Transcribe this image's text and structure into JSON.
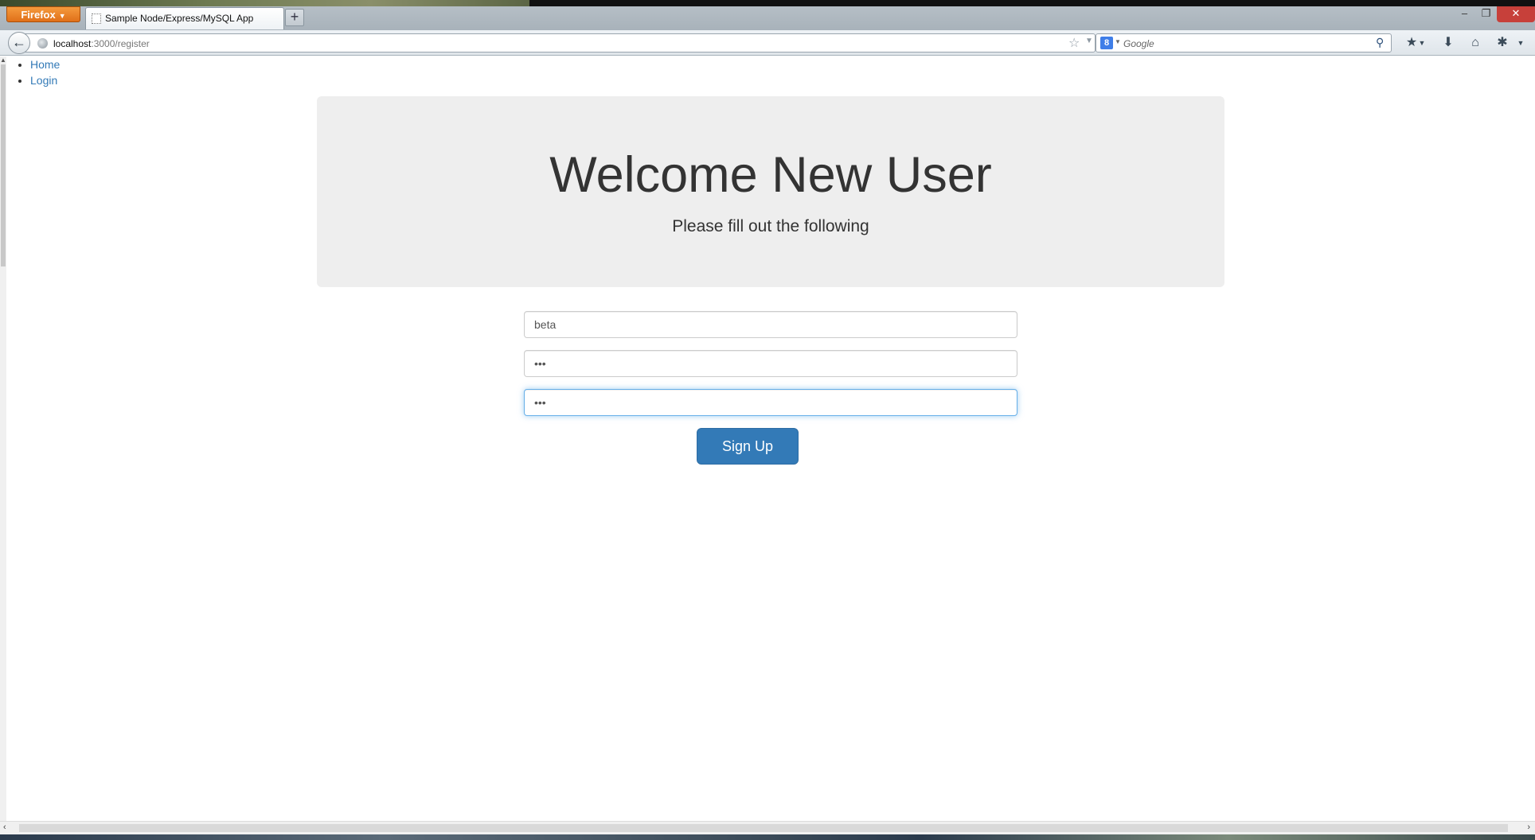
{
  "browser": {
    "app_button_label": "Firefox",
    "tab_title": "Sample Node/Express/MySQL App",
    "new_tab_label": "+",
    "url_host": "localhost",
    "url_path": ":3000/register",
    "search_engine_placeholder": "Google",
    "search_engine_icon_letter": "8"
  },
  "nav": {
    "items": [
      {
        "label": "Home"
      },
      {
        "label": "Login"
      }
    ]
  },
  "jumbotron": {
    "title": "Welcome New User",
    "subtitle": "Please fill out the following"
  },
  "form": {
    "username_value": "beta",
    "password_value": "•••",
    "confirm_value": "•••",
    "submit_label": "Sign Up"
  },
  "colors": {
    "primary": "#337ab7",
    "jumbotron_bg": "#eeeeee",
    "firefox_orange": "#e0701a",
    "close_red": "#c7403a"
  }
}
